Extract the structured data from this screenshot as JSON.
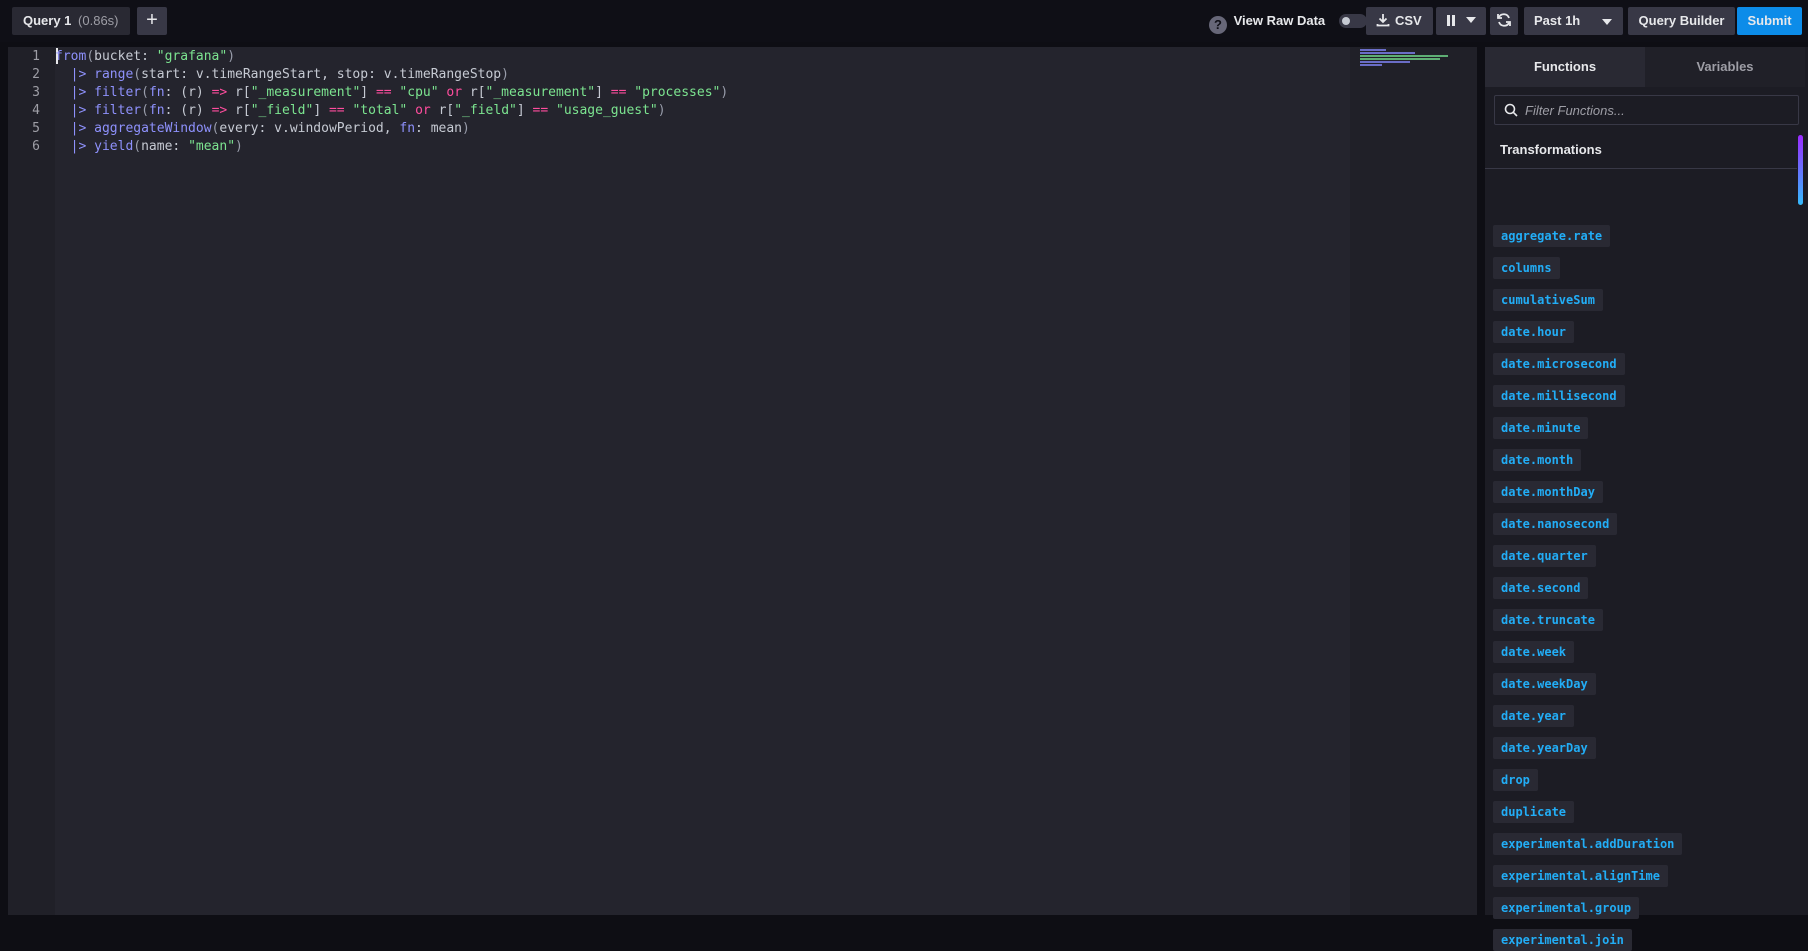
{
  "toolbar": {
    "query_tab_label": "Query 1",
    "query_tab_time": "(0.86s)",
    "add_query_symbol": "+",
    "view_raw_data_label": "View Raw Data",
    "view_raw_data_enabled": false,
    "csv_label": "CSV",
    "time_range_label": "Past 1h",
    "query_builder_label": "Query Builder",
    "submit_label": "Submit"
  },
  "editor": {
    "lines": [
      "from(bucket: \"grafana\")",
      "  |> range(start: v.timeRangeStart, stop: v.timeRangeStop)",
      "  |> filter(fn: (r) => r[\"_measurement\"] == \"cpu\" or r[\"_measurement\"] == \"processes\")",
      "  |> filter(fn: (r) => r[\"_field\"] == \"total\" or r[\"_field\"] == \"usage_guest\")",
      "  |> aggregateWindow(every: v.windowPeriod, fn: mean)",
      "  |> yield(name: \"mean\")"
    ]
  },
  "panel": {
    "tabs": [
      "Functions",
      "Variables"
    ],
    "active_tab": "Functions",
    "search_placeholder": "Filter Functions...",
    "section_title": "Transformations",
    "functions": [
      "aggregate.rate",
      "columns",
      "cumulativeSum",
      "date.hour",
      "date.microsecond",
      "date.millisecond",
      "date.minute",
      "date.month",
      "date.monthDay",
      "date.nanosecond",
      "date.quarter",
      "date.second",
      "date.truncate",
      "date.week",
      "date.weekDay",
      "date.year",
      "date.yearDay",
      "drop",
      "duplicate",
      "experimental.addDuration",
      "experimental.alignTime",
      "experimental.group",
      "experimental.join"
    ]
  },
  "colors": {
    "accent": "#0c8ce9",
    "function_text": "#22adf6",
    "keyword": "#8e91fc",
    "string": "#7ce490",
    "operator": "#ff4d9e"
  }
}
